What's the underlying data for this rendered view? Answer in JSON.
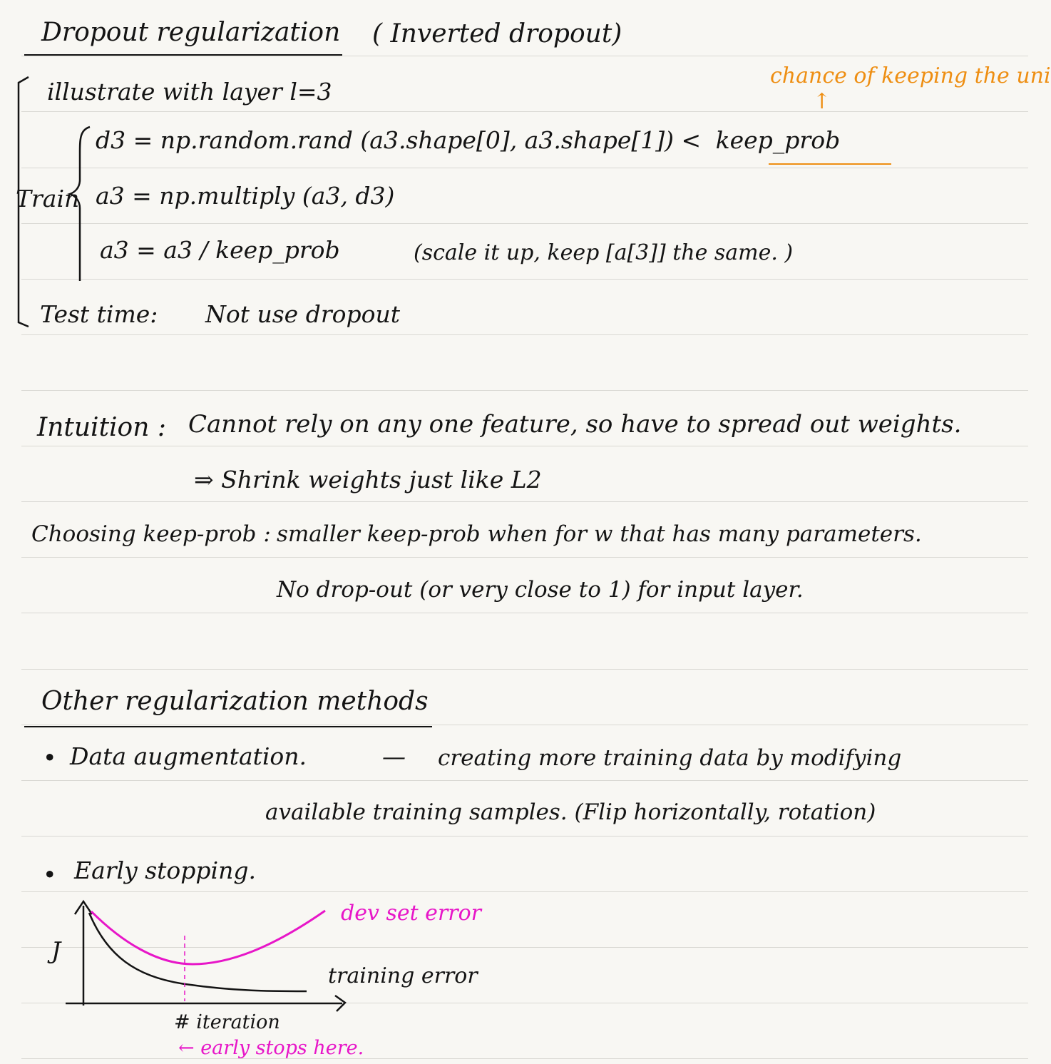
{
  "section1": {
    "title": "Dropout regularization",
    "subtitle": "( Inverted dropout)",
    "illustrate": "illustrate with layer l=3",
    "note": "chance of keeping the unit.",
    "train_label": "Train",
    "line1_prefix": "d3 = np.random.rand (a3.shape[0], a3.shape[1]) <",
    "line1_keep": "keep_prob",
    "line2": "a3 = np.multiply (a3, d3)",
    "line3": "a3 = a3 / keep_prob",
    "line3_comment": "(scale it up, keep [a[3]] the same. )",
    "test_time": "Test time:",
    "test_note": "Not use dropout"
  },
  "section2": {
    "intuition_label": "Intuition :",
    "intuition_text": "Cannot rely on any one feature, so have to spread out weights.",
    "shrink": "⇒ Shrink weights just like L2",
    "choosing_label": "Choosing keep-prob :",
    "choosing_text": "smaller keep-prob when for w that has many parameters.",
    "no_dropout": "No drop-out (or very close to 1) for input layer."
  },
  "section3": {
    "title": "Other regularization methods",
    "bullet1_label": "Data augmentation.",
    "bullet1_dash": "—",
    "bullet1_text": "creating more training data by modifying",
    "bullet1_text2": "available training samples. (Flip horizontally, rotation)",
    "bullet2_label": "Early stopping."
  },
  "graph": {
    "ylabel": "J",
    "dev_label": "dev set error",
    "train_label": "training error",
    "xlabel": "# iteration",
    "early_label": "← early stops here."
  },
  "colors": {
    "orange": "#ee8e12",
    "magenta": "#e716c8",
    "ink": "#141414"
  }
}
